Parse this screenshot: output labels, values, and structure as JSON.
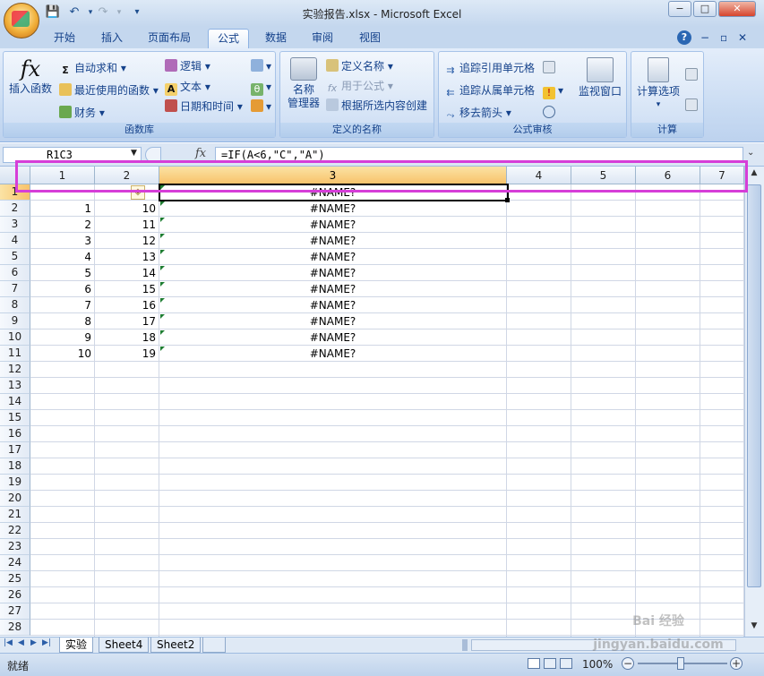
{
  "window": {
    "title": "实验报告.xlsx - Microsoft Excel",
    "min": "−",
    "max": "□",
    "close": "✕"
  },
  "qat": {
    "save": "💾",
    "undo": "↶",
    "redo": "↷",
    "more": "▾"
  },
  "tabs": [
    "开始",
    "插入",
    "页面布局",
    "公式",
    "数据",
    "审阅",
    "视图"
  ],
  "ribbon_right": {
    "help": "?",
    "min": "−",
    "restore": "▫",
    "close": "✕"
  },
  "ribbon": {
    "function_library": {
      "label": "函数库",
      "insert_function": "插入函数",
      "autosum": "自动求和",
      "recent": "最近使用的函数",
      "financial": "财务",
      "logical": "逻辑",
      "text": "文本",
      "datetime": "日期和时间"
    },
    "defined_names": {
      "label": "定义的名称",
      "name_manager": "名称\n管理器",
      "define_name": "定义名称",
      "use_in_formula": "用于公式",
      "create_from_selection": "根据所选内容创建"
    },
    "formula_auditing": {
      "label": "公式审核",
      "trace_precedents": "追踪引用单元格",
      "trace_dependents": "追踪从属单元格",
      "remove_arrows": "移去箭头",
      "watch_window": "监视窗口"
    },
    "calculation": {
      "label": "计算",
      "options": "计算选项"
    }
  },
  "formula_bar": {
    "name_box": "R1C3",
    "fx": "fx",
    "formula": "=IF(A<6,\"C\",\"A\")"
  },
  "columns": [
    "1",
    "2",
    "3",
    "4",
    "5",
    "6",
    "7"
  ],
  "rows": [
    "1",
    "2",
    "3",
    "4",
    "5",
    "6",
    "7",
    "8",
    "9",
    "10",
    "11",
    "12",
    "13",
    "14",
    "15",
    "16",
    "17",
    "18",
    "19",
    "20",
    "21",
    "22",
    "23",
    "24",
    "25",
    "26",
    "27",
    "28"
  ],
  "data_rows": [
    {
      "c1": "",
      "c2": "",
      "c3": "#NAME?"
    },
    {
      "c1": "1",
      "c2": "10",
      "c3": "#NAME?"
    },
    {
      "c1": "2",
      "c2": "11",
      "c3": "#NAME?"
    },
    {
      "c1": "3",
      "c2": "12",
      "c3": "#NAME?"
    },
    {
      "c1": "4",
      "c2": "13",
      "c3": "#NAME?"
    },
    {
      "c1": "5",
      "c2": "14",
      "c3": "#NAME?"
    },
    {
      "c1": "6",
      "c2": "15",
      "c3": "#NAME?"
    },
    {
      "c1": "7",
      "c2": "16",
      "c3": "#NAME?"
    },
    {
      "c1": "8",
      "c2": "17",
      "c3": "#NAME?"
    },
    {
      "c1": "9",
      "c2": "18",
      "c3": "#NAME?"
    },
    {
      "c1": "10",
      "c2": "19",
      "c3": "#NAME?"
    }
  ],
  "sheets": [
    "实验",
    "Sheet4",
    "Sheet2"
  ],
  "status": {
    "ready": "就绪",
    "zoom": "100%"
  },
  "watermark": "Bai 经验 jingyan.baidu.com",
  "colors": {
    "highlight": "#d63ed8",
    "selected_header": "#f8c36b",
    "ribbon": "#c7daf2"
  }
}
